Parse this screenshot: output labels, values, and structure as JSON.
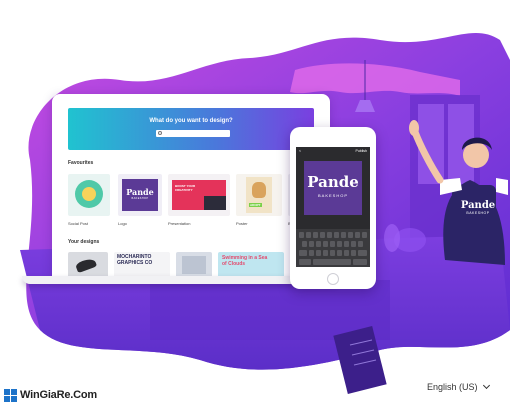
{
  "laptop": {
    "hero_title": "What do you want to design?",
    "favourites_label": "Favourites",
    "your_designs_label": "Your designs",
    "favourites": [
      {
        "label": "Social Post"
      },
      {
        "label": "Logo"
      },
      {
        "label": "Presentation"
      },
      {
        "label": "Poster"
      },
      {
        "label": "Bu"
      }
    ],
    "logo_card": {
      "title": "Pande",
      "sub": "BAKESHOP"
    },
    "presentation_card": {
      "text": "BOOST YOUR CREATIVITY"
    },
    "poster_card": {
      "text": "ADOPT"
    },
    "designs": [
      {
        "text": ""
      },
      {
        "text": "MOCHARINTO GRAPHICS CO"
      },
      {
        "text": ""
      },
      {
        "text": "Swimming in a Sea of Clouds"
      }
    ]
  },
  "phone": {
    "top_right": "Publish",
    "top_left": "<",
    "logo_title": "Pande",
    "logo_sub": "BAKESHOP"
  },
  "apron": {
    "title": "Pande",
    "sub": "BAKESHOP"
  },
  "footer": {
    "brand": "WinGiaRe.Com",
    "language": "English (US)"
  },
  "colors": {
    "purple": "#6a2fd6",
    "magenta": "#c33cd8",
    "teal": "#20c3d0",
    "windows_blue": "#1d73c9"
  }
}
